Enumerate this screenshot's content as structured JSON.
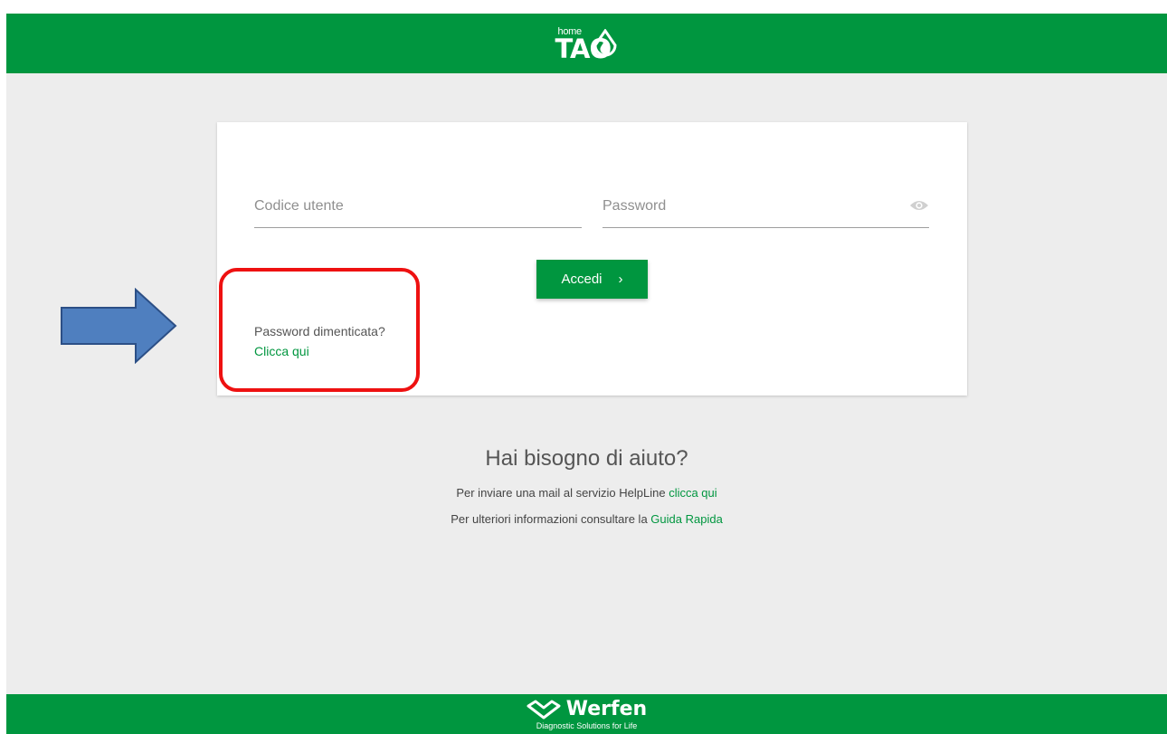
{
  "header": {
    "logo_home": "home",
    "logo_tao": "TAO",
    "background": "#00963f"
  },
  "login": {
    "user_placeholder": "Codice utente",
    "user_value": "",
    "password_placeholder": "Password",
    "password_value": "",
    "submit_label": "Accedi",
    "submit_chevron": "›",
    "forgot_label": "Password dimenticata?",
    "forgot_link": "Clicca qui"
  },
  "help": {
    "title": "Hai bisogno di aiuto?",
    "mail_text": "Per inviare una mail al servizio HelpLine ",
    "mail_link": "clicca qui",
    "guide_text": "Per ulteriori informazioni consultare la ",
    "guide_link": "Guida Rapida"
  },
  "footer": {
    "brand": "Werfen",
    "tagline": "Diagnostic Solutions for Life"
  },
  "annotation": {
    "highlight_color": "#ee1111",
    "arrow_color": "#4f7fbf"
  },
  "icons": [
    "home-tao-logo-icon",
    "eye-icon",
    "chevron-right-icon",
    "werfen-logo-icon",
    "annotation-arrow-icon"
  ]
}
